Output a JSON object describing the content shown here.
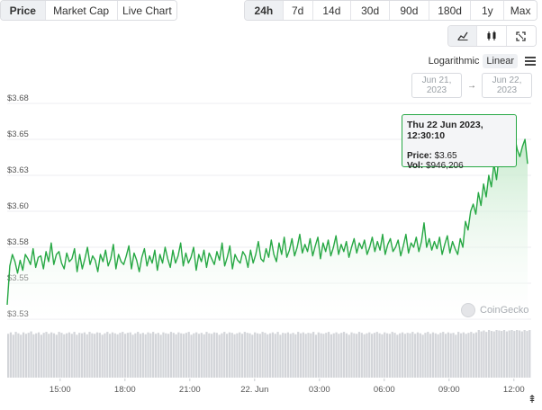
{
  "tabs": {
    "type": [
      {
        "label": "Price",
        "active": true
      },
      {
        "label": "Market Cap",
        "active": false
      },
      {
        "label": "Live Chart",
        "active": false
      }
    ],
    "range": [
      {
        "label": "24h",
        "active": true
      },
      {
        "label": "7d",
        "active": false
      },
      {
        "label": "14d",
        "active": false
      },
      {
        "label": "30d",
        "active": false
      },
      {
        "label": "90d",
        "active": false
      },
      {
        "label": "180d",
        "active": false
      },
      {
        "label": "1y",
        "active": false
      },
      {
        "label": "Max",
        "active": false
      }
    ],
    "views": [
      {
        "icon": "line-chart-icon",
        "active": true
      },
      {
        "icon": "candlestick-icon",
        "active": false
      },
      {
        "icon": "fullscreen-icon",
        "active": false
      }
    ]
  },
  "scale": {
    "log_label": "Logarithmic",
    "linear_label": "Linear",
    "selected": "Linear"
  },
  "date_range": {
    "from": "Jun 21, 2023",
    "to": "Jun 22, 2023",
    "arrow": "→"
  },
  "tooltip": {
    "date": "Thu 22 Jun 2023, 12:30:10",
    "price_label": "Price:",
    "price_value": "$3.65",
    "vol_label": "Vol:",
    "vol_value": "$946,206"
  },
  "brand": {
    "name": "CoinGecko"
  },
  "colors": {
    "line": "#27a844",
    "fill_top": "#bfe7c6",
    "volume": "#d3d5d9",
    "grid": "#eceef1",
    "axis_text": "#555555"
  },
  "chart_data": {
    "type": "area",
    "x_tick_labels": [
      "15:00",
      "18:00",
      "21:00",
      "22. Jun",
      "03:00",
      "06:00",
      "09:00",
      "12:00"
    ],
    "y_tick_labels": [
      "$3.53",
      "$3.55",
      "$3.58",
      "$3.60",
      "$3.63",
      "$3.65",
      "$3.68"
    ],
    "y_ticks": [
      3.53,
      3.555,
      3.58,
      3.605,
      3.63,
      3.655,
      3.68
    ],
    "ylim": [
      3.53,
      3.68
    ],
    "x_start_hour": 12.55,
    "x_end_hour": 36.8,
    "series": [
      {
        "values": [
          3.54,
          3.567,
          3.575,
          3.57,
          3.562,
          3.571,
          3.564,
          3.575,
          3.572,
          3.568,
          3.579,
          3.566,
          3.573,
          3.574,
          3.565,
          3.577,
          3.57,
          3.583,
          3.568,
          3.575,
          3.577,
          3.569,
          3.565,
          3.576,
          3.57,
          3.572,
          3.579,
          3.563,
          3.575,
          3.565,
          3.572,
          3.58,
          3.568,
          3.574,
          3.571,
          3.563,
          3.575,
          3.57,
          3.578,
          3.567,
          3.572,
          3.582,
          3.565,
          3.575,
          3.57,
          3.568,
          3.574,
          3.581,
          3.565,
          3.576,
          3.571,
          3.563,
          3.573,
          3.579,
          3.567,
          3.574,
          3.569,
          3.578,
          3.564,
          3.575,
          3.569,
          3.58,
          3.572,
          3.566,
          3.578,
          3.569,
          3.574,
          3.583,
          3.567,
          3.576,
          3.569,
          3.573,
          3.58,
          3.564,
          3.575,
          3.57,
          3.578,
          3.566,
          3.576,
          3.572,
          3.568,
          3.577,
          3.571,
          3.583,
          3.567,
          3.573,
          3.581,
          3.565,
          3.575,
          3.571,
          3.569,
          3.577,
          3.574,
          3.566,
          3.578,
          3.569,
          3.575,
          3.584,
          3.572,
          3.57,
          3.579,
          3.573,
          3.585,
          3.575,
          3.57,
          3.583,
          3.575,
          3.587,
          3.573,
          3.578,
          3.586,
          3.574,
          3.58,
          3.589,
          3.576,
          3.582,
          3.577,
          3.586,
          3.574,
          3.581,
          3.587,
          3.572,
          3.583,
          3.577,
          3.585,
          3.574,
          3.58,
          3.588,
          3.575,
          3.582,
          3.577,
          3.584,
          3.573,
          3.58,
          3.586,
          3.576,
          3.583,
          3.579,
          3.585,
          3.575,
          3.58,
          3.587,
          3.577,
          3.584,
          3.578,
          3.589,
          3.575,
          3.582,
          3.586,
          3.577,
          3.58,
          3.585,
          3.574,
          3.581,
          3.589,
          3.576,
          3.583,
          3.58,
          3.587,
          3.577,
          3.584,
          3.597,
          3.58,
          3.586,
          3.578,
          3.584,
          3.579,
          3.587,
          3.575,
          3.582,
          3.588,
          3.576,
          3.584,
          3.579,
          3.575,
          3.586,
          3.58,
          3.598,
          3.592,
          3.605,
          3.61,
          3.603,
          3.618,
          3.609,
          3.624,
          3.615,
          3.63,
          3.622,
          3.638,
          3.627,
          3.644,
          3.636,
          3.648,
          3.639,
          3.654,
          3.645,
          3.657,
          3.648,
          3.643,
          3.65,
          3.655,
          3.638
        ]
      }
    ],
    "volume": [
      0.92,
      0.95,
      0.9,
      0.96,
      0.93,
      0.9,
      0.95,
      0.92,
      0.94,
      0.97,
      0.91,
      0.93,
      0.95,
      0.9,
      0.94,
      0.96,
      0.92,
      0.95,
      0.93,
      0.9,
      0.96,
      0.94,
      0.91,
      0.93,
      0.95,
      0.92,
      0.96,
      0.9,
      0.94,
      0.93,
      0.95,
      0.91,
      0.96,
      0.93,
      0.92,
      0.95,
      0.94,
      0.9,
      0.93,
      0.96,
      0.92,
      0.95,
      0.93,
      0.91,
      0.94,
      0.96,
      0.92,
      0.94,
      0.95,
      0.9,
      0.93,
      0.96,
      0.92,
      0.94,
      0.91,
      0.95,
      0.93,
      0.96,
      0.92,
      0.94,
      0.9,
      0.95,
      0.93,
      0.92,
      0.96,
      0.94,
      0.91,
      0.95,
      0.93,
      0.92,
      0.94,
      0.96,
      0.9,
      0.93,
      0.95,
      0.92,
      0.94,
      0.91,
      0.96,
      0.93,
      0.92,
      0.95,
      0.94,
      0.9,
      0.93,
      0.96,
      0.92,
      0.95,
      0.94,
      0.91,
      0.93,
      0.95,
      0.92,
      0.96,
      0.94,
      0.93,
      0.9,
      0.95,
      0.93,
      0.92,
      0.96,
      0.94,
      0.91,
      0.93,
      0.95,
      0.92,
      0.96,
      0.9,
      0.94,
      0.93,
      0.95,
      0.92,
      0.94,
      0.91,
      0.96,
      0.93,
      0.95,
      0.92,
      0.94,
      0.93,
      0.96,
      0.9,
      0.95,
      0.93,
      0.92,
      0.94,
      0.96,
      0.91,
      0.93,
      0.95,
      0.92,
      0.94,
      0.96,
      0.93,
      0.9,
      0.95,
      0.93,
      0.92,
      0.96,
      0.94,
      0.91,
      0.93,
      0.95,
      0.92,
      0.94,
      0.96,
      0.93,
      0.91,
      0.95,
      0.93,
      0.92,
      0.96,
      0.94,
      0.9,
      0.93,
      0.95,
      0.92,
      0.94,
      0.93,
      0.96,
      0.92,
      0.95,
      0.93,
      0.9,
      0.94,
      0.96,
      0.92,
      0.95,
      0.93,
      0.91,
      0.94,
      0.96,
      0.92,
      0.95,
      0.93,
      0.94,
      0.9,
      0.96,
      0.93,
      0.95,
      0.92,
      0.94,
      0.96,
      0.93,
      0.95,
      1.0,
      0.97,
      0.99,
      0.96,
      1.0,
      0.98,
      0.97,
      1.0,
      0.99,
      0.98,
      1.0,
      0.97,
      0.99,
      1.0,
      0.98,
      1.0,
      0.99,
      0.97,
      1.0,
      0.98,
      1.0
    ]
  }
}
